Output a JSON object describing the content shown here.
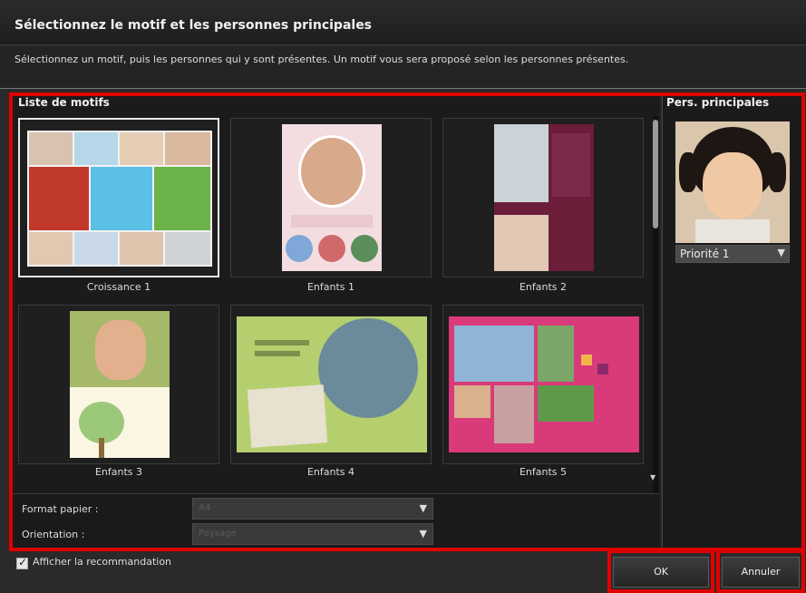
{
  "dialog": {
    "title": "Sélectionnez le motif et les personnes principales",
    "subtitle": "Sélectionnez un motif, puis les personnes qui y sont présentes. Un motif vous sera proposé selon les personnes présentes."
  },
  "motif_list": {
    "title": "Liste de motifs",
    "items": [
      {
        "label": "Croissance 1",
        "selected": true
      },
      {
        "label": "Enfants 1",
        "selected": false
      },
      {
        "label": "Enfants 2",
        "selected": false
      },
      {
        "label": "Enfants 3",
        "selected": false
      },
      {
        "label": "Enfants 4",
        "selected": false
      },
      {
        "label": "Enfants 5",
        "selected": false
      }
    ]
  },
  "format": {
    "paper_label": "Format papier :",
    "paper_value": "A4",
    "orientation_label": "Orientation :",
    "orientation_value": "Paysage"
  },
  "persons": {
    "title": "Pers. principales",
    "priority": "Priorité 1"
  },
  "footer": {
    "checkbox_label": "Afficher la recommandation",
    "checkbox_checked": true,
    "ok_label": "OK",
    "cancel_label": "Annuler"
  },
  "colors": {
    "highlight": "#e00000",
    "background": "#1b1b1b"
  }
}
